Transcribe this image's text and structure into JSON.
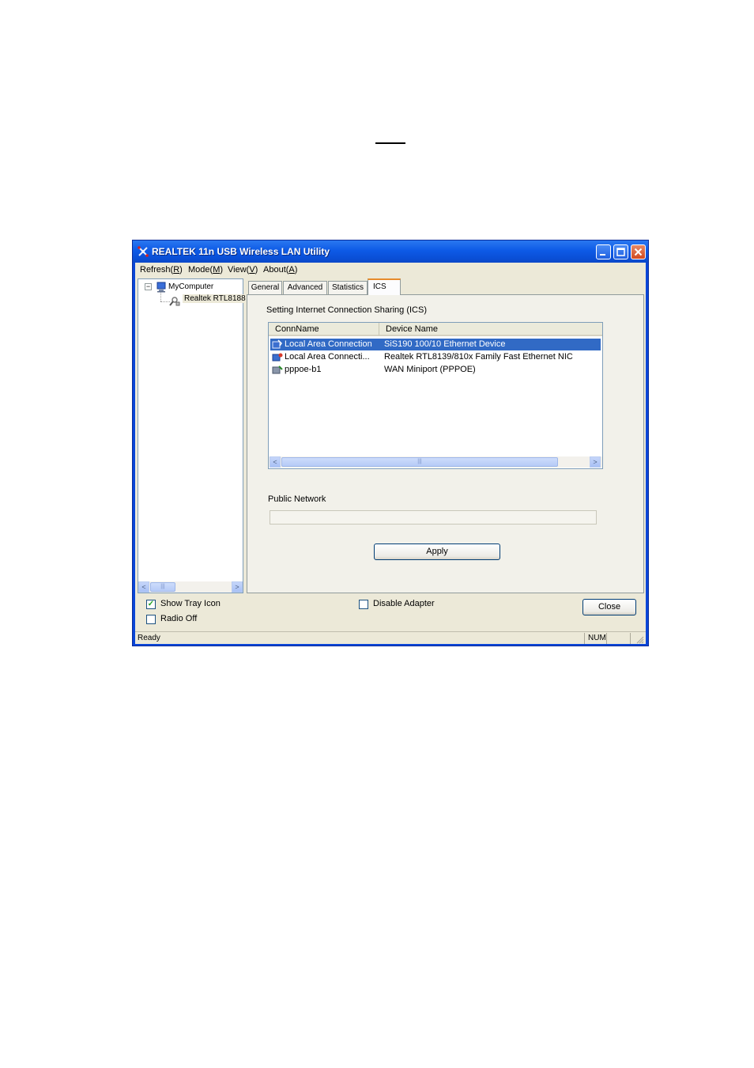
{
  "window": {
    "title": "REALTEK 11n USB Wireless LAN Utility"
  },
  "menu": [
    {
      "label": "Refresh(",
      "key": "R",
      "tail": ")"
    },
    {
      "label": "Mode(",
      "key": "M",
      "tail": ")"
    },
    {
      "label": "View(",
      "key": "V",
      "tail": ")"
    },
    {
      "label": "About(",
      "key": "A",
      "tail": ")"
    }
  ],
  "tree": {
    "root": "MyComputer",
    "child": "Realtek RTL8188"
  },
  "tabs": [
    "General",
    "Advanced",
    "Statistics",
    "ICS"
  ],
  "active_tab": "ICS",
  "ics": {
    "heading": "Setting Internet Connection Sharing (ICS)",
    "columns": [
      "ConnName",
      "Device Name"
    ],
    "rows": [
      {
        "conn": "Local Area Connection",
        "device": "SiS190 100/10 Ethernet Device",
        "selected": true
      },
      {
        "conn": "Local Area Connecti...",
        "device": "Realtek RTL8139/810x Family Fast Ethernet NIC",
        "selected": false
      },
      {
        "conn": "pppoe-b1",
        "device": "WAN Miniport (PPPOE)",
        "selected": false
      }
    ],
    "public_network_label": "Public Network",
    "public_network_value": "",
    "apply_label": "Apply"
  },
  "options": {
    "show_tray_icon": {
      "label": "Show Tray Icon",
      "checked": true
    },
    "radio_off": {
      "label": "Radio Off",
      "checked": false
    },
    "disable_adapter": {
      "label": "Disable Adapter",
      "checked": false
    }
  },
  "close_label": "Close",
  "status": {
    "text": "Ready",
    "num": "NUM"
  },
  "colors": {
    "title_bar": "#0d5ae6",
    "selection": "#316ac5",
    "active_tab_accent": "#e68b2c",
    "dialog_face": "#ece9d8"
  }
}
